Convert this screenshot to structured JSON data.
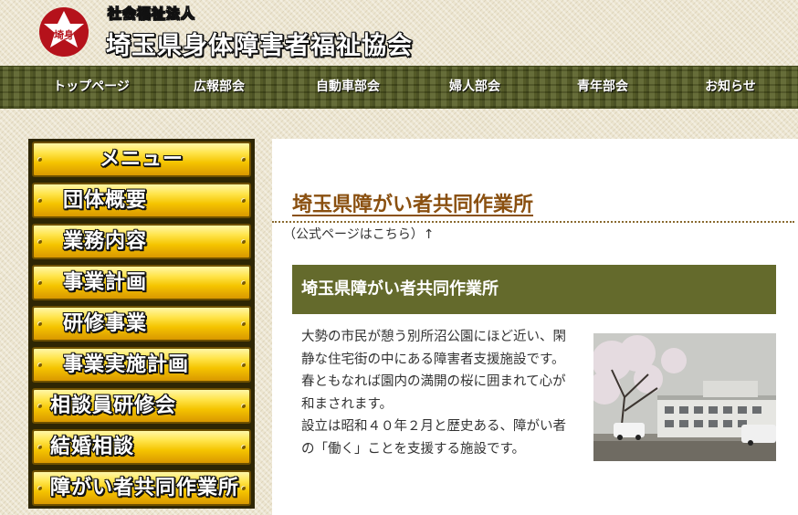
{
  "header": {
    "logo_text": "埼身",
    "org_type": "社会福祉法人",
    "org_name": "埼玉県身体障害者福祉協会"
  },
  "nav": {
    "items": [
      {
        "label": "トップページ"
      },
      {
        "label": "広報部会"
      },
      {
        "label": "自動車部会"
      },
      {
        "label": "婦人部会"
      },
      {
        "label": "青年部会"
      },
      {
        "label": "お知らせ"
      }
    ]
  },
  "sidebar": {
    "title": "メニュー",
    "items": [
      {
        "label": "団体概要"
      },
      {
        "label": "業務内容"
      },
      {
        "label": "事業計画"
      },
      {
        "label": "研修事業"
      },
      {
        "label": "事業実施計画"
      },
      {
        "label": "相談員研修会"
      },
      {
        "label": "結婚相談"
      },
      {
        "label": "障がい者共同作業所"
      }
    ]
  },
  "main": {
    "page_title": "埼玉県障がい者共同作業所",
    "official_link": "（公式ページはこちら）↑",
    "section_title": "埼玉県障がい者共同作業所",
    "paragraphs": [
      "大勢の市民が憩う別所沼公園にほど近い、閑静な住宅街の中にある障害者支援施設です。",
      "春ともなれば園内の満開の桜に囲まれて心が和まされます。",
      "設立は昭和４０年２月と歴史ある、障がい者の「働く」ことを支援する施設です。"
    ]
  },
  "colors": {
    "nav_bg": "#545c22",
    "section_bar": "#646a2c",
    "title_link": "#8a5010",
    "menu_gold": "#f5c400",
    "logo_red": "#b5121b"
  }
}
